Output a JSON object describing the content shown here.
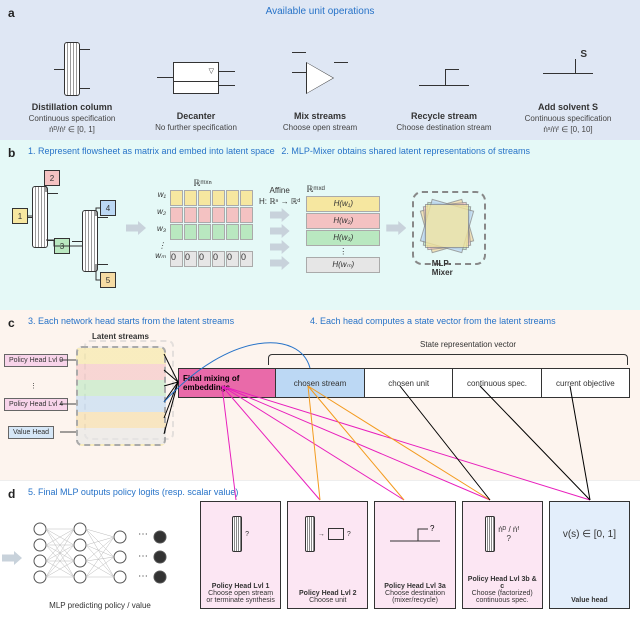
{
  "panelA": {
    "label": "a",
    "title": "Available unit operations",
    "ops": [
      {
        "name": "Distillation column",
        "sub": "Continuous specification",
        "spec": "ṅᴰ/ṅᶠ ∈ [0, 1]"
      },
      {
        "name": "Decanter",
        "sub": "No further specification",
        "spec": ""
      },
      {
        "name": "Mix streams",
        "sub": "Choose open stream",
        "spec": ""
      },
      {
        "name": "Recycle stream",
        "sub": "Choose destination stream",
        "spec": ""
      },
      {
        "name": "Add solvent S",
        "sub": "Continuous specification",
        "spec": "ṅˢ/ṅᶠ ∈ [0, 10]"
      }
    ]
  },
  "panelB": {
    "label": "b",
    "cap1": "1. Represent flowsheet as matrix and embed into latent space",
    "cap2": "2. MLP-Mixer obtains shared latent representations of streams",
    "mat_dim": "ℝᵐˣⁿ",
    "affine1": "Affine",
    "affine2": "H: ℝⁿ → ℝᵈ",
    "H_dim": "ℝᵐˣᵈ",
    "rows": [
      "w₁",
      "w₂",
      "w₃",
      "⋮",
      "wₘ"
    ],
    "Hrows": [
      "H(w₁)",
      "H(w₂)",
      "H(w₃)",
      "⋮",
      "H(wₘ)"
    ],
    "mixer": "MLP-Mixer"
  },
  "panelC": {
    "label": "c",
    "cap1": "3. Each network head starts from the latent streams",
    "cap2": "4. Each head computes a state vector from the latent streams",
    "latent": "Latent streams",
    "staterep": "State representation vector",
    "heads": {
      "h0": "Policy Head Lvl 0",
      "dots": "⋮",
      "h4": "Policy Head Lvl 4",
      "hv": "Value Head"
    },
    "cells": [
      "Final mixing of embeddings",
      "chosen stream",
      "chosen unit",
      "continuous spec.",
      "current objective"
    ]
  },
  "panelD": {
    "label": "d",
    "cap1": "5. Final MLP outputs policy logits (resp. scalar value)",
    "mlp_sub": "MLP predicting policy / value",
    "boxes": [
      {
        "title": "Policy Head Lvl 1",
        "sub": "Choose open stream or terminate synthesis"
      },
      {
        "title": "Policy Head Lvl 2",
        "sub": "Choose unit"
      },
      {
        "title": "Policy Head Lvl 3a",
        "sub": "Choose destination (mixer/recycle)"
      },
      {
        "title": "Policy Head Lvl 3b & c",
        "sub": "Choose (factorized) continuous spec."
      },
      {
        "title": "Value head",
        "sub": ""
      }
    ],
    "frac": "ṅᴰ / ṅᶠ",
    "value_expr": "v(s) ∈ [0, 1]"
  }
}
